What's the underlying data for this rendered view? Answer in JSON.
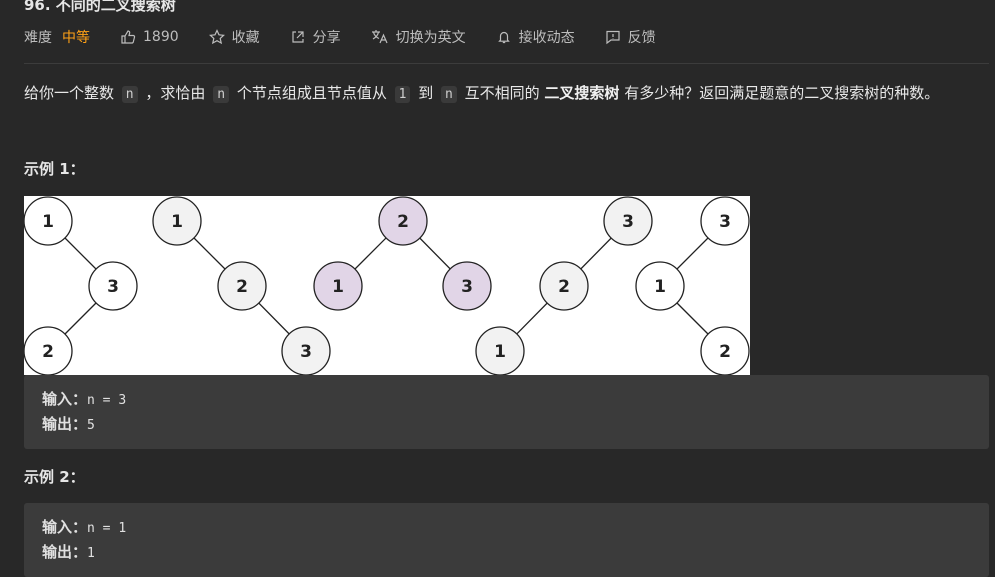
{
  "problem": {
    "title": "96. 不同的二叉搜索树",
    "difficulty_label": "难度",
    "difficulty_value": "中等",
    "likes": "1890",
    "favorite_label": "收藏",
    "share_label": "分享",
    "switch_lang_label": "切换为英文",
    "notify_label": "接收动态",
    "feedback_label": "反馈"
  },
  "description": {
    "p1": "给你一个整数",
    "code_n": "n",
    "p2": "，求恰由",
    "p3": "个节点组成且节点值从",
    "code_1": "1",
    "p4": "到",
    "p5": "互不相同的",
    "bold": "二叉搜索树",
    "p6": "有多少种？返回满足题意的二叉搜索树的种数。"
  },
  "example1": {
    "title": "示例 1：",
    "input_key": "输入：",
    "input_value": "n = 3",
    "output_key": "输出：",
    "output_value": "5"
  },
  "example2": {
    "title": "示例 2：",
    "input_key": "输入：",
    "input_value": "n = 1",
    "output_key": "输出：",
    "output_value": "1"
  },
  "figure": {
    "trees": [
      {
        "nodes": [
          "1",
          "3",
          "2"
        ],
        "highlighted": false
      },
      {
        "nodes": [
          "1",
          "2",
          "3"
        ],
        "highlighted": false
      },
      {
        "nodes": [
          "2",
          "1",
          "3"
        ],
        "highlighted": true
      },
      {
        "nodes": [
          "3",
          "2",
          "1"
        ],
        "highlighted": false
      },
      {
        "nodes": [
          "3",
          "1",
          "2"
        ],
        "highlighted": false
      }
    ],
    "colors": {
      "white": "#ffffff",
      "light": "#f2f2f2",
      "highlight": "#e1d5e7",
      "stroke": "#222222"
    }
  }
}
